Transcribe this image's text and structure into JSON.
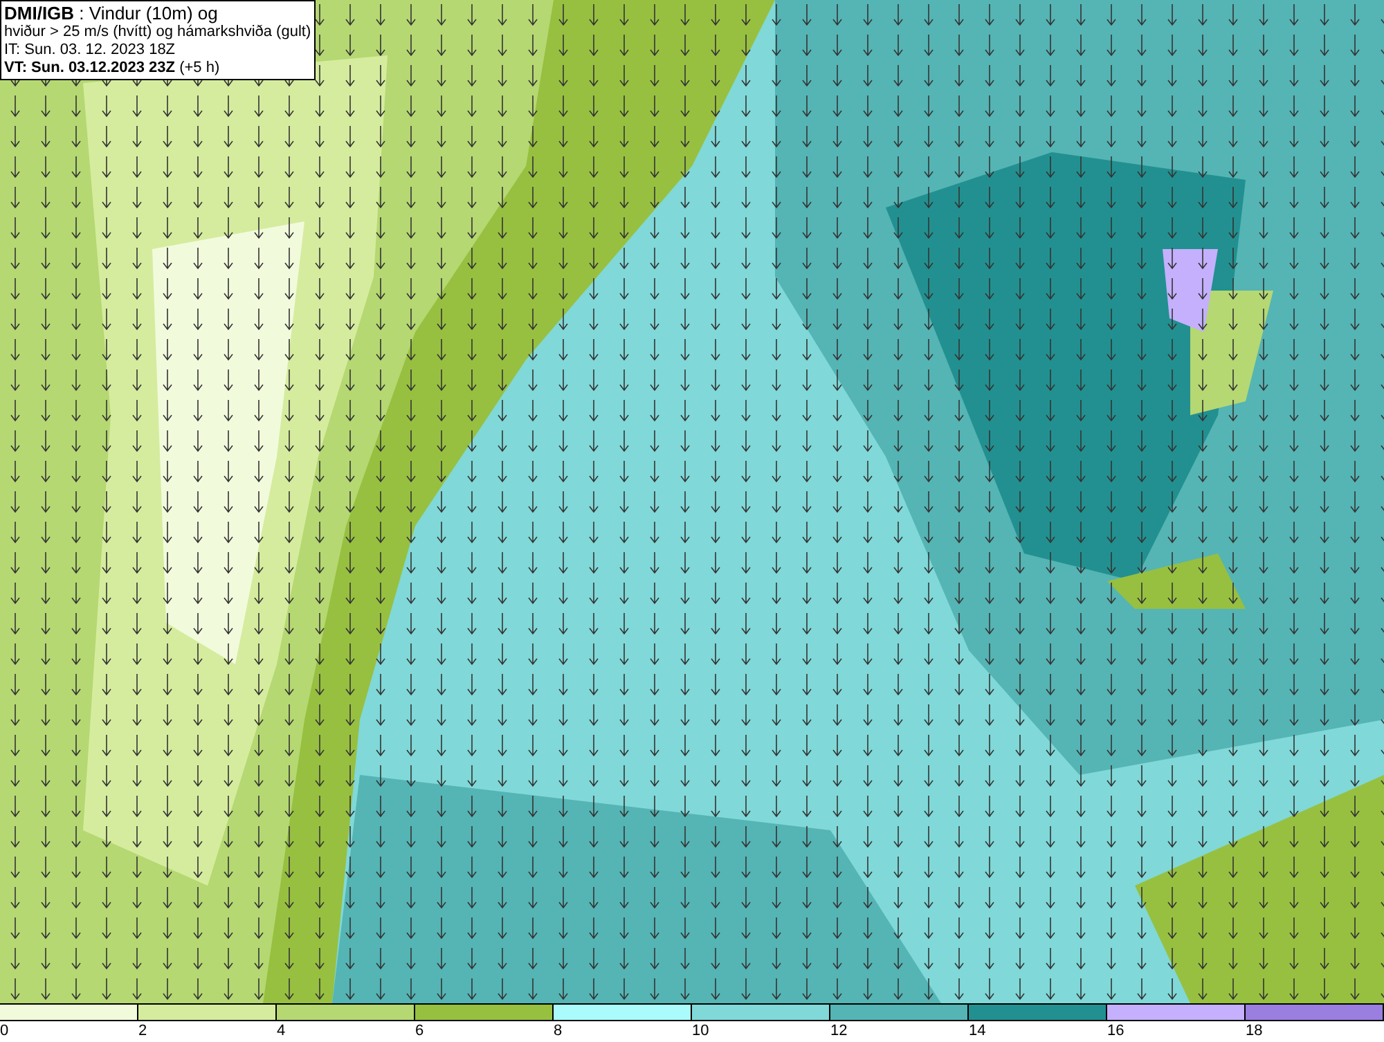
{
  "title_box": {
    "lines": [
      "**DMI/IGB** : Vindur (10m) og",
      "hviður > 25 m/s (hvítt) og hámarkshviða (gult)",
      "IT: Sun. 03. 12. 2023 18Z",
      "**VT: Sun. 03.12.2023 23Z** (+5 h)"
    ]
  },
  "legend": [
    {
      "label": "0",
      "color": "#f2fadc"
    },
    {
      "label": "2",
      "color": "#d5ec9e"
    },
    {
      "label": "4",
      "color": "#b5d872"
    },
    {
      "label": "6",
      "color": "#97c040"
    },
    {
      "label": "8",
      "color": "#aafcfc"
    },
    {
      "label": "10",
      "color": "#80d8d8"
    },
    {
      "label": "12",
      "color": "#55b4b4"
    },
    {
      "label": "14",
      "color": "#229090"
    },
    {
      "label": "16",
      "color": "#c4b0fc"
    },
    {
      "label": "18",
      "color": "#9a7ee0"
    }
  ]
}
